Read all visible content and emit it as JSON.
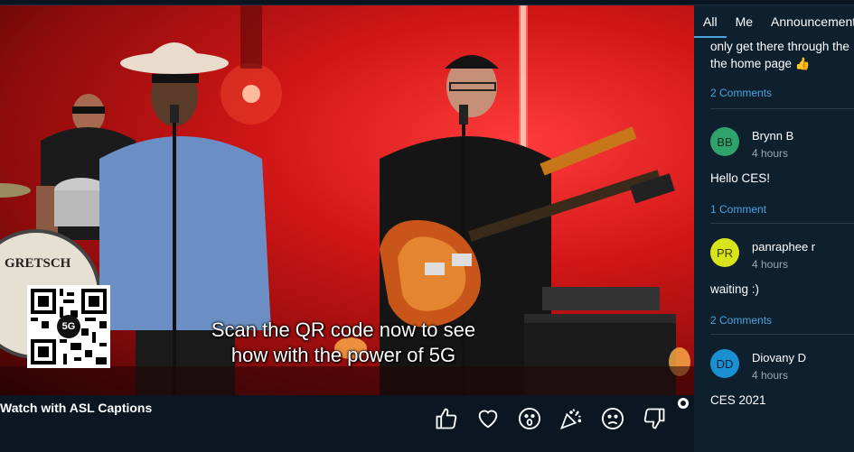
{
  "video": {
    "caption_lines": [
      "Scan the QR code now to see",
      "how with the power of 5G"
    ],
    "qr_badge": "5G",
    "drum_brand": "GRETSCH"
  },
  "bottombar": {
    "asl_label": "Watch with ASL Captions",
    "reactions": [
      "thumbs-up-icon",
      "heart-icon",
      "surprised-face-icon",
      "party-popper-icon",
      "sad-face-icon",
      "thumbs-down-icon"
    ]
  },
  "panel": {
    "tabs": [
      "All",
      "Me",
      "Announcements"
    ],
    "active_tab": "All",
    "partial_post": {
      "text_lines": [
        "only get there through the",
        "the home page 👍"
      ],
      "comments": "2 Comments"
    },
    "posts": [
      {
        "initials": "BB",
        "author": "Brynn B",
        "time": "4 hours",
        "text": "Hello CES!",
        "comments": "1 Comment",
        "avatar_color": "#2fa36b",
        "avatar_text_color": "#0b2a1a"
      },
      {
        "initials": "PR",
        "author": "panraphee r",
        "time": "4 hours",
        "text": "waiting :)",
        "comments": "2 Comments",
        "avatar_color": "#d7e31b",
        "avatar_text_color": "#3a3a00"
      },
      {
        "initials": "DD",
        "author": "Diovany D",
        "time": "4 hours",
        "text": "CES 2021",
        "comments": "",
        "avatar_color": "#1a8fd1",
        "avatar_text_color": "#0b2236"
      }
    ]
  },
  "colors": {
    "accent": "#4aa3df",
    "panel_bg": "#0e1f2e",
    "stage_red": "#d11616"
  }
}
